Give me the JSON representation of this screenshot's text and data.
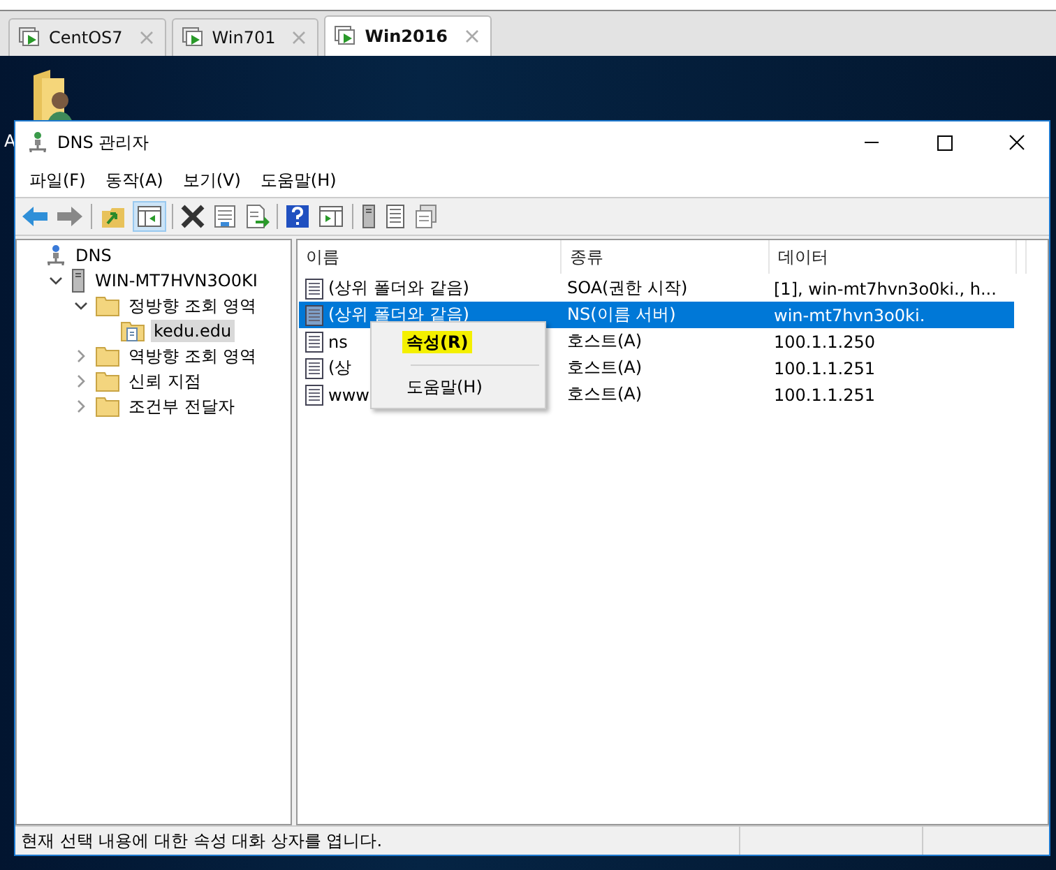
{
  "vm_tabs": [
    {
      "label": "CentOS7",
      "selected": false
    },
    {
      "label": "Win701",
      "selected": false
    },
    {
      "label": "Win2016",
      "selected": true
    }
  ],
  "desktop_icon": {
    "label": "A"
  },
  "window": {
    "title": "DNS 관리자"
  },
  "menu": [
    "파일(F)",
    "동작(A)",
    "보기(V)",
    "도움말(H)"
  ],
  "tree": [
    {
      "label": "DNS",
      "kind": "root",
      "selected": false,
      "children": [
        {
          "label": "WIN-MT7HVN3O0KI",
          "kind": "server",
          "expanded": true,
          "selected": false,
          "children": [
            {
              "label": "정방향 조회 영역",
              "kind": "folder",
              "expanded": true,
              "selected": false,
              "children": [
                {
                  "label": "kedu.edu",
                  "kind": "zone",
                  "selected": true
                }
              ]
            },
            {
              "label": "역방향 조회 영역",
              "kind": "folder",
              "expanded": false,
              "selected": false
            },
            {
              "label": "신뢰 지점",
              "kind": "folder",
              "expanded": false,
              "selected": false
            },
            {
              "label": "조건부 전달자",
              "kind": "folder",
              "expanded": false,
              "selected": false
            }
          ]
        }
      ]
    }
  ],
  "table": {
    "columns": [
      "이름",
      "종류",
      "데이터"
    ],
    "rows": [
      {
        "name": "(상위 폴더와 같음)",
        "type": "SOA(권한 시작)",
        "data": "[1], win-mt7hvn3o0ki., h...",
        "selected": false
      },
      {
        "name": "(상위 폴더와 같음)",
        "type": "NS(이름 서버)",
        "data": "win-mt7hvn3o0ki.",
        "selected": true
      },
      {
        "name": "ns",
        "type": "호스트(A)",
        "data": "100.1.1.250",
        "selected": false
      },
      {
        "name": "(상",
        "type": "호스트(A)",
        "data": "100.1.1.251",
        "selected": false
      },
      {
        "name": "www",
        "type": "호스트(A)",
        "data": "100.1.1.251",
        "selected": false
      }
    ]
  },
  "context_menu": [
    {
      "label": "속성(R)",
      "highlighted": true
    },
    {
      "label": "도움말(H)",
      "highlighted": false
    }
  ],
  "status_bar": "현재 선택 내용에 대한 속성 대화 상자를 엽니다."
}
